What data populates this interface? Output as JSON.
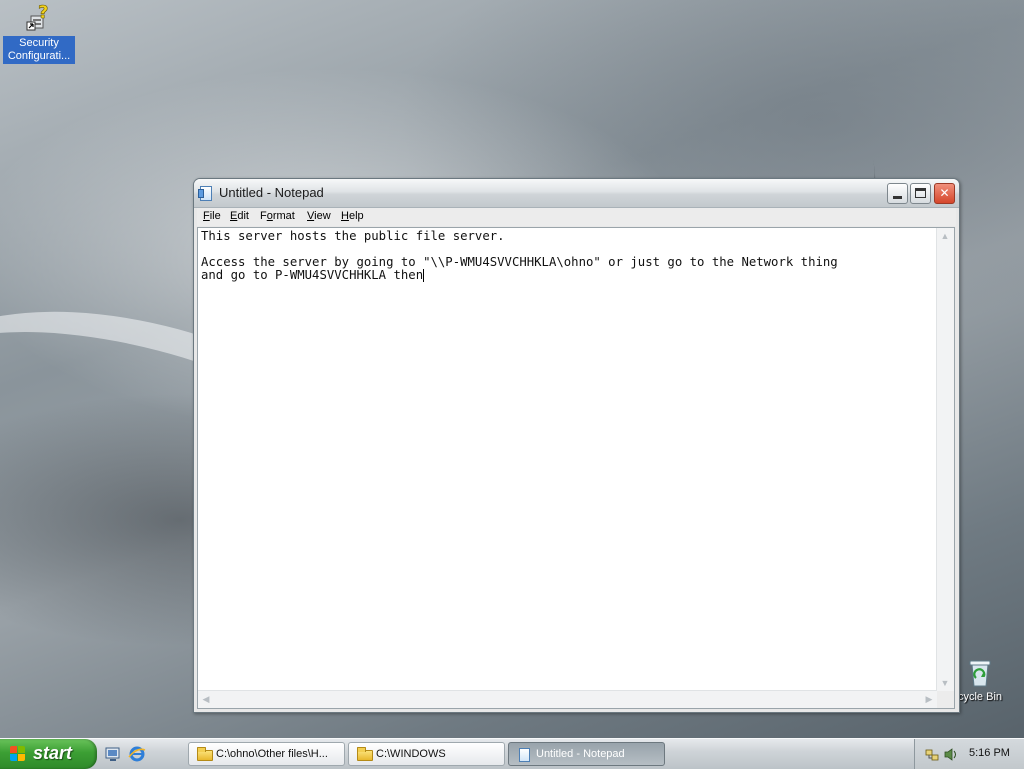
{
  "desktop": {
    "icons": [
      {
        "label": "Security Configurati...",
        "icon": "security-config-icon"
      },
      {
        "label": "cycle Bin",
        "icon": "recycle-bin-icon"
      }
    ]
  },
  "notepad": {
    "title": "Untitled - Notepad",
    "menu": [
      {
        "label": "File",
        "accel": "F",
        "rest": "ile"
      },
      {
        "label": "Edit",
        "accel": "E",
        "rest": "dit"
      },
      {
        "label": "Format",
        "accel": "o",
        "pre": "F",
        "rest": "rmat"
      },
      {
        "label": "View",
        "accel": "V",
        "rest": "iew"
      },
      {
        "label": "Help",
        "accel": "H",
        "rest": "elp"
      }
    ],
    "lines": [
      "This server hosts the public file server.",
      "",
      "Access the server by going to \"\\\\P-WMU4SVVCHHKLA\\ohno\" or just go to the Network thing",
      "and go to P-WMU4SVVCHHKLA then"
    ]
  },
  "taskbar": {
    "start_label": "start",
    "quick_launch": [
      "show-desktop-icon",
      "internet-explorer-icon"
    ],
    "tasks": [
      {
        "label": "C:\\ohno\\Other files\\H...",
        "icon": "folder-icon",
        "active": false
      },
      {
        "label": "C:\\WINDOWS",
        "icon": "folder-icon",
        "active": false
      },
      {
        "label": "Untitled - Notepad",
        "icon": "notepad-icon",
        "active": true
      }
    ],
    "tray": {
      "icons": [
        "network-tray-icon",
        "volume-tray-icon"
      ],
      "clock": "5:16 PM"
    }
  },
  "colors": {
    "start_green": "#3c9f34",
    "selection_blue": "#316ac5",
    "close_red": "#d5462b"
  }
}
